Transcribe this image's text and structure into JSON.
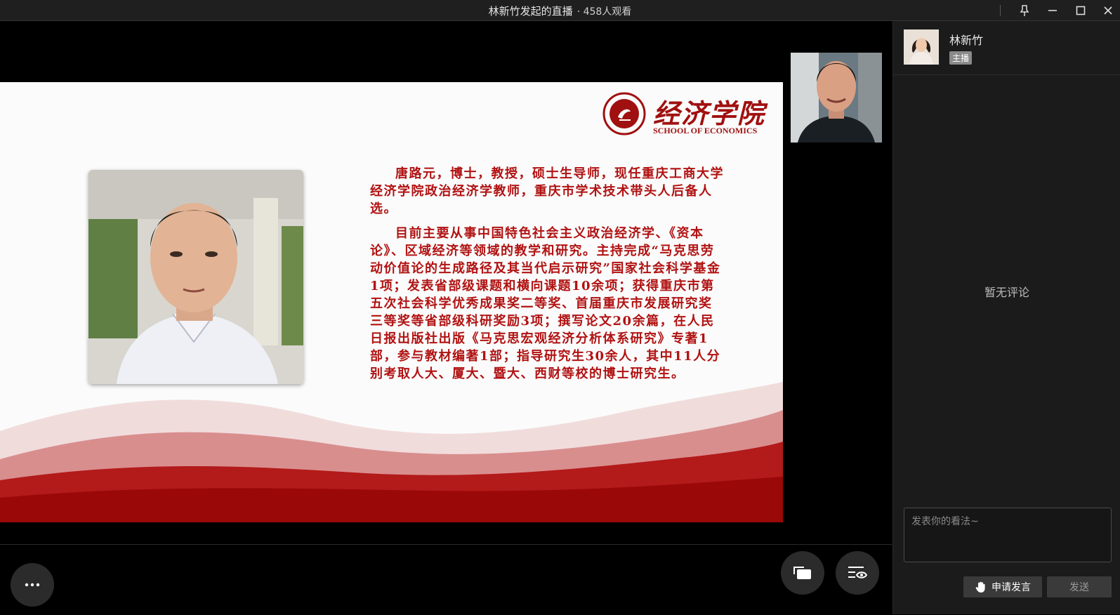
{
  "window": {
    "title": "林新竹发起的直播",
    "viewers": "· 458人观看",
    "icons": [
      "pin-icon",
      "minimize-icon",
      "maximize-icon",
      "close-icon"
    ]
  },
  "slide": {
    "logo_title": "经济学院",
    "logo_subtitle": "SCHOOL OF ECONOMICS",
    "bio_paragraph_1": "唐路元，博士，教授，硕士生导师，现任重庆工商大学经济学院政治经济学教师，重庆市学术技术带头人后备人选。",
    "bio_paragraph_2": "目前主要从事中国特色社会主义政治经济学、《资本论》、区域经济等领域的教学和研究。主持完成“马克思劳动价值论的生成路径及其当代启示研究”国家社会科学基金1项；发表省部级课题和横向课题10余项；获得重庆市第五次社会科学优秀成果奖二等奖、首届重庆市发展研究奖三等奖等省部级科研奖励3项；撰写论文20余篇，在人民日报出版社出版《马克思宏观经济分析体系研究》专著1部，参与教材编著1部；指导研究生30余人，其中11人分别考取人大、厦大、暨大、西财等校的博士研究生。",
    "accent_color": "#b11212"
  },
  "host": {
    "name": "林新竹",
    "role_badge": "主播"
  },
  "comments": {
    "empty_text": "暂无评论",
    "input_placeholder": "发表你的看法~",
    "raise_hand_label": "申请发言",
    "send_label": "发送"
  },
  "controls": {
    "more_icon": "more-icon",
    "layout_icon": "layout-switch-icon",
    "view_icon": "view-settings-icon"
  }
}
